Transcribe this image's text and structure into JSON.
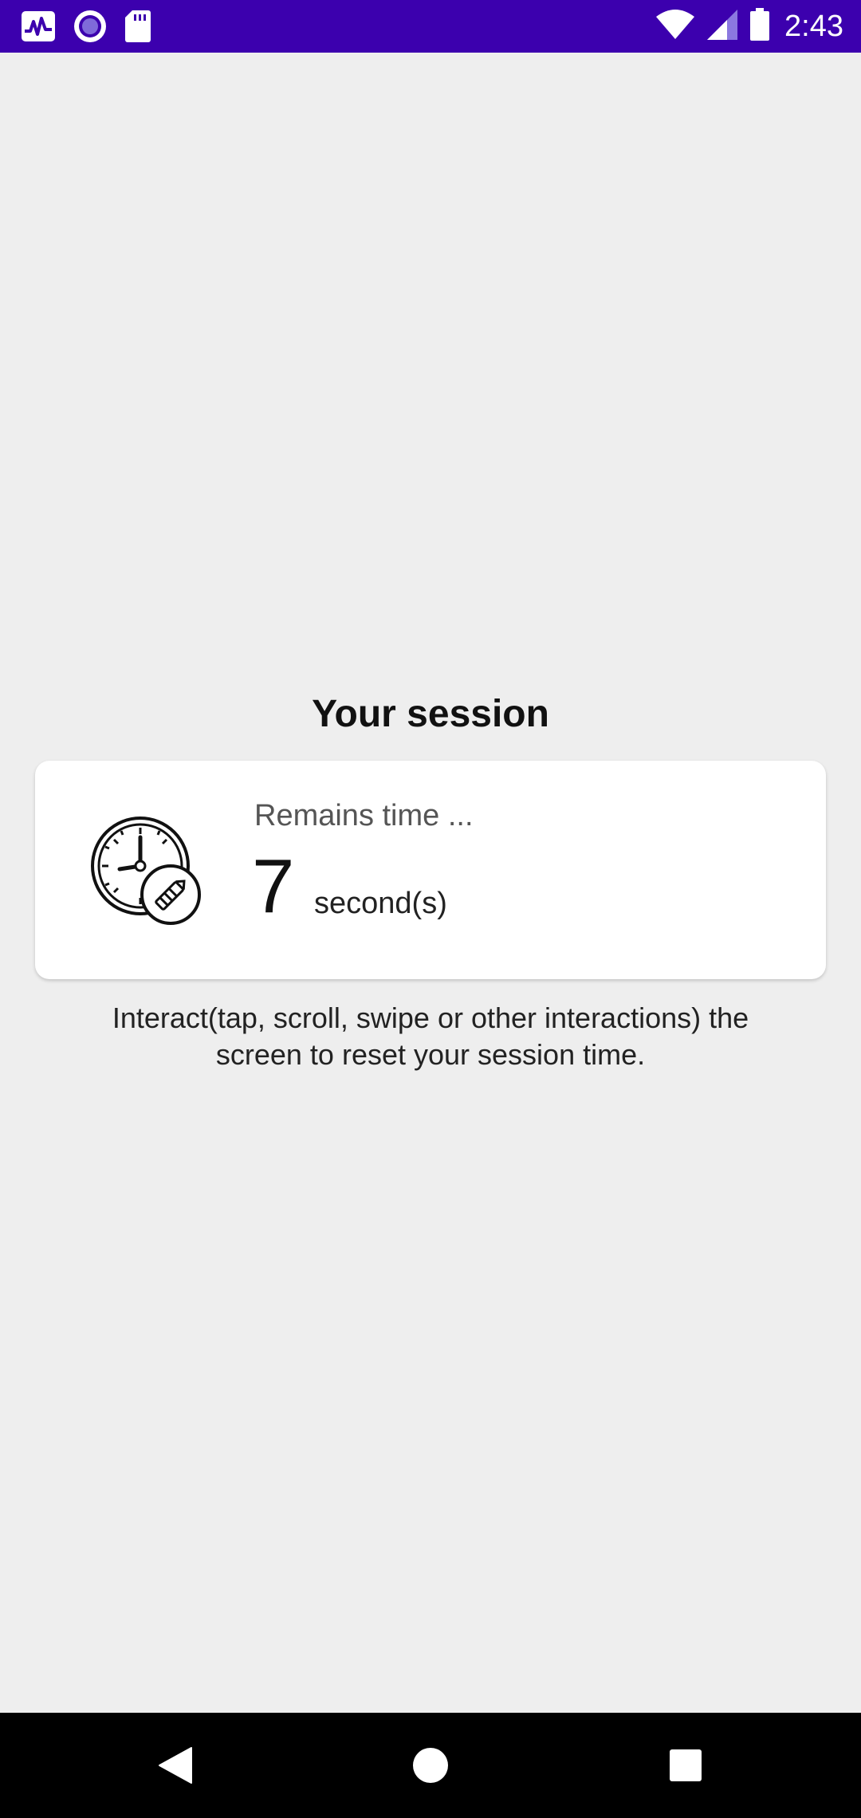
{
  "status_bar": {
    "time": "2:43",
    "icons": [
      "activity-icon",
      "record-icon",
      "sd-card-icon",
      "wifi-icon",
      "signal-icon",
      "battery-icon"
    ],
    "background": "#3c00ae"
  },
  "session": {
    "title": "Your session",
    "remains_label": "Remains time ...",
    "seconds_value": "7",
    "seconds_unit": "second(s)",
    "icon": "clock-timer-icon"
  },
  "hint": {
    "text": "Interact(tap, scroll, swipe or other interactions) the screen to reset your session time."
  },
  "nav_bar": {
    "buttons": [
      "back-icon",
      "home-icon",
      "recents-icon"
    ]
  }
}
